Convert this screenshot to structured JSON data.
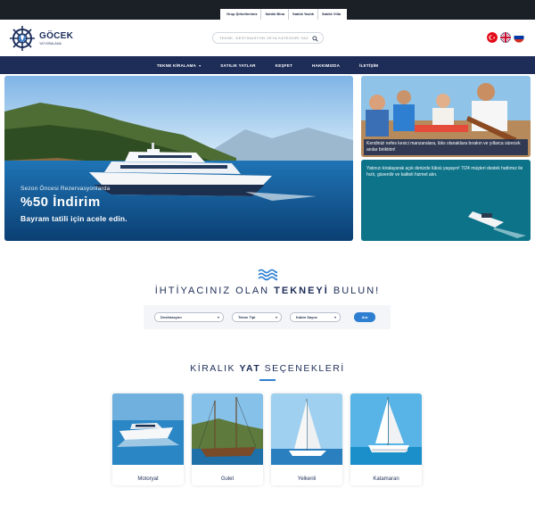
{
  "topbar": {
    "links": [
      "Grup Şirketlerimiz",
      "Satılık Bina",
      "Satılık Yazlık",
      "Satılık Villa"
    ]
  },
  "header": {
    "logo_title": "GÖCEK",
    "logo_subtitle": "YAT KİRALAMA",
    "search_placeholder": "TEKNE, DESTİNASYON VEYA KATEGORİ YAZINIZ",
    "flags": [
      "tr-flag-icon",
      "uk-flag-icon",
      "ru-flag-icon"
    ]
  },
  "nav": {
    "items": [
      "TEKNE KİRALAMA",
      "SATILIK YATLAR",
      "KEŞFET",
      "HAKKIMIZDA",
      "İLETİŞİM"
    ]
  },
  "hero": {
    "line1": "Sezon Öncesi Rezervasyonlarda",
    "line2": "%50 İndirim",
    "line3": "Bayram tatili için acele edin."
  },
  "side": {
    "top_caption": "Kendinizi nefes kesici manzaralara, lüks olanaklara bırakın ve yıllarca sürecek anılar biriktirin!",
    "bottom_caption": "Yatınızı kiralayarak açık denizde lüksü yaşayın! 7/24 müşteri destek hattımız ile hızlı, güvenilir ve kaliteli hizmet alın."
  },
  "finder": {
    "title_pre": "İHTİYACINIZ OLAN ",
    "title_bold": "TEKNEYİ",
    "title_post": " BULUN!",
    "select1": "Destinasyon",
    "select2": "Tekne Tipi",
    "select3": "Kabin Sayısı",
    "button": "Ara"
  },
  "kiralik": {
    "title_pre": "KİRALIK ",
    "title_bold": "YAT",
    "title_post": " SEÇENEKLERİ",
    "cards": [
      "Motoryat",
      "Gulet",
      "Yelkenli",
      "Katamaran"
    ]
  },
  "colors": {
    "navy": "#1e2d58",
    "accent": "#2e7fd1",
    "topbar": "#1b1f26"
  }
}
